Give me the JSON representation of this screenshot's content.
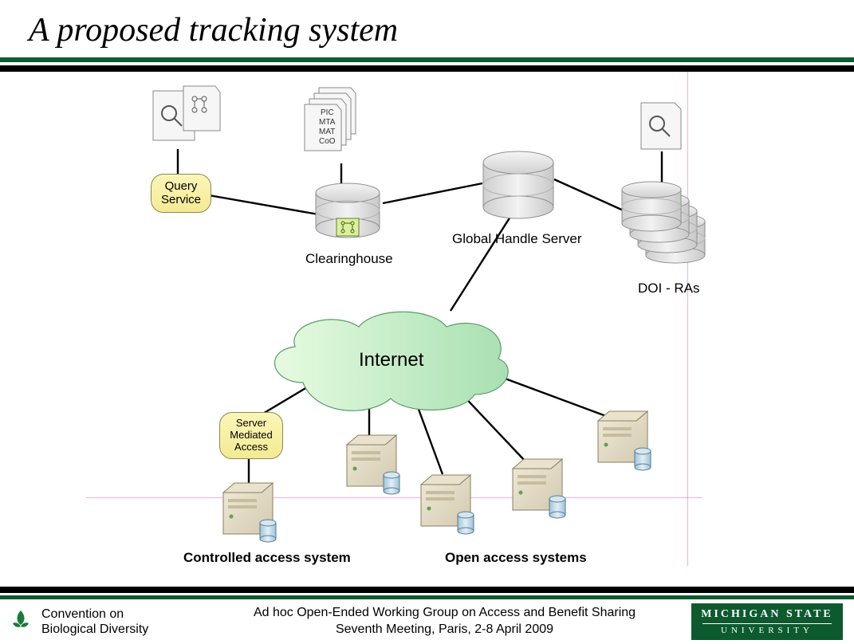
{
  "title": "A proposed tracking system",
  "nodes": {
    "query_service": "Query\nService",
    "clearinghouse": "Clearinghouse",
    "doc_labels": [
      "PIC",
      "MTA",
      "MAT",
      "CoO"
    ],
    "global_handle_server": "Global Handle Server",
    "doi_ras": "DOI - RAs",
    "internet": "Internet",
    "server_mediated_access": "Server\nMediated\nAccess",
    "controlled_access_system": "Controlled access system",
    "open_access_systems": "Open access systems"
  },
  "footer": {
    "left_line1": "Convention on",
    "left_line2": "Biological Diversity",
    "center_line1": "Ad hoc Open-Ended Working Group on Access and Benefit Sharing",
    "center_line2": "Seventh Meeting, Paris, 2-8 April 2009",
    "right_line1": "MICHIGAN STATE",
    "right_line2": "UNIVERSITY"
  }
}
